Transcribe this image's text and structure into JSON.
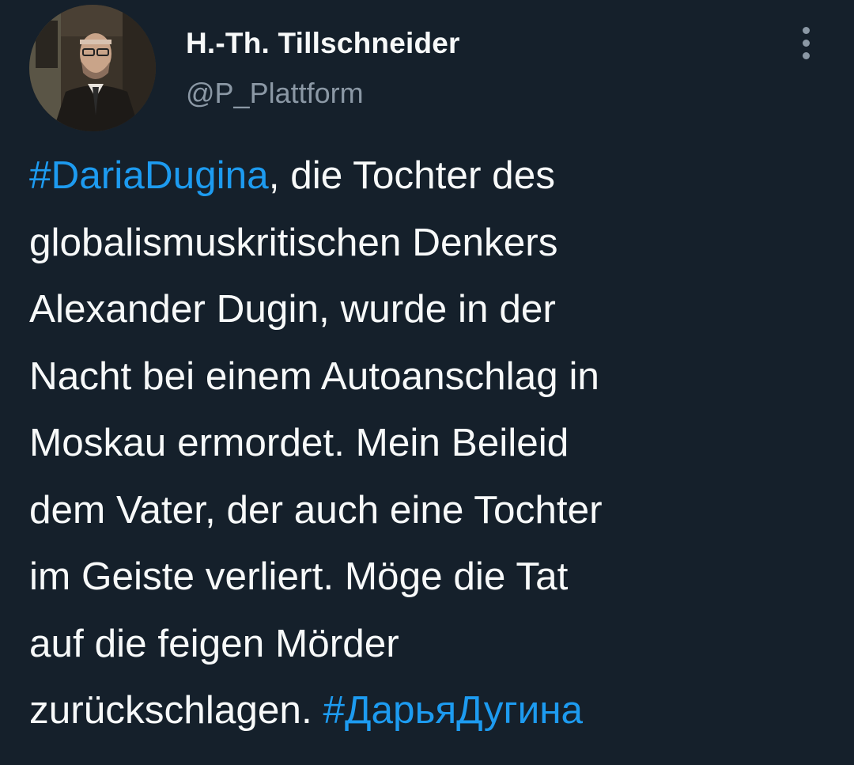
{
  "author": {
    "display_name": "H.-Th. Tillschneider",
    "handle": "@P_Plattform",
    "avatar_icon": "profile-photo"
  },
  "menu": {
    "icon": "more-vertical-icon"
  },
  "tweet": {
    "hashtag_1": "#DariaDugina",
    "line1_rest": ", die Tochter des",
    "line2": "globalismuskritischen Denkers",
    "line3": "Alexander Dugin, wurde in der",
    "line4": "Nacht bei einem Autoanschlag in",
    "line5": "Moskau ermordet. Mein Beileid",
    "line6": "dem Vater, der auch eine Tochter",
    "line7": "im Geiste verliert. Möge die Tat",
    "line8": "auf die feigen Mörder",
    "line9_start": "zurückschlagen. ",
    "hashtag_2": "#ДарьяДугина"
  },
  "colors": {
    "background": "#15202b",
    "text": "#f7f9f9",
    "secondary_text": "#8b98a5",
    "link": "#1d9bf0"
  }
}
